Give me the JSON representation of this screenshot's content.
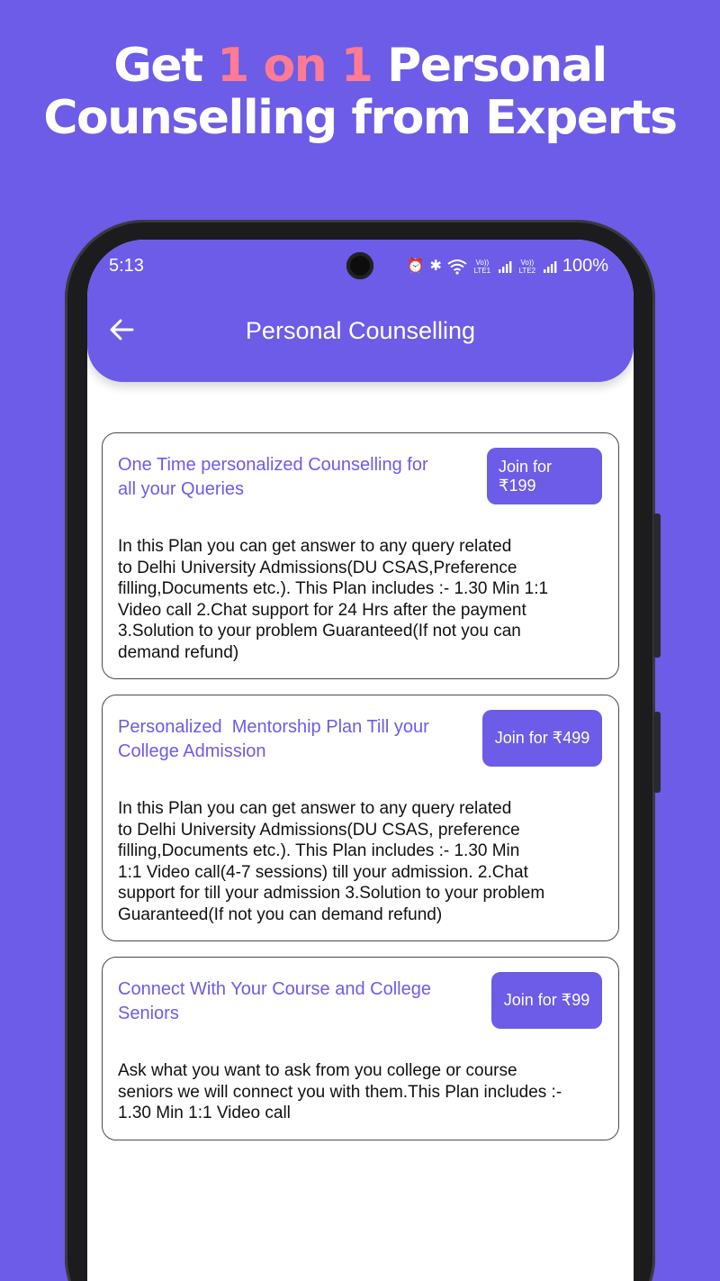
{
  "headline": {
    "pre": "Get ",
    "accent": "1 on 1",
    "post": " Personal",
    "line2": "Counselling from Experts"
  },
  "status_bar": {
    "time": "5:13",
    "battery": "100%",
    "icons": [
      "alarm-icon",
      "bluetooth-icon",
      "wifi-icon",
      "signal-icon",
      "signal-icon"
    ],
    "sim1_label": "Vo)) LTE1",
    "sim2_label": "Vo)) LTE2"
  },
  "app_bar": {
    "title": "Personal Counselling",
    "back_icon": "arrow-left-icon"
  },
  "plans": [
    {
      "title_l1": "One Time personalized Counselling for",
      "title_l2": "all your Queries",
      "button": "Join for ₹199",
      "desc": [
        "In this Plan you can get answer to any query related",
        "to Delhi University Admissions(DU CSAS,Preference",
        "filling,Documents etc.). This Plan includes :- 1.30 Min 1:1",
        "Video call 2.Chat support for 24 Hrs after the payment",
        "3.Solution to your problem Guaranteed(If not you can",
        "demand refund)"
      ]
    },
    {
      "title_l1": "Personalized  Mentorship Plan Till your",
      "title_l2": "College Admission",
      "button": "Join for ₹499",
      "desc": [
        "In this Plan you can get answer to any query related",
        "to Delhi University Admissions(DU CSAS, preference",
        "filling,Documents etc.). This Plan includes :- 1.30 Min",
        "1:1 Video call(4-7 sessions) till your admission. 2.Chat",
        "support for till your admission 3.Solution to your problem",
        "Guaranteed(If not you can demand refund)"
      ]
    },
    {
      "title_l1": "Connect With Your Course and College",
      "title_l2": "Seniors",
      "button": "Join for ₹99",
      "desc": [
        "Ask what you want to ask from you college or course",
        "seniors we will connect you with them.This Plan includes :-",
        "1.30 Min 1:1 Video call"
      ]
    }
  ],
  "colors": {
    "background": "#6C5CE7",
    "accent": "#FF7A93",
    "title_text": "#6C5CE7",
    "button_bg": "#6C5CE7"
  }
}
